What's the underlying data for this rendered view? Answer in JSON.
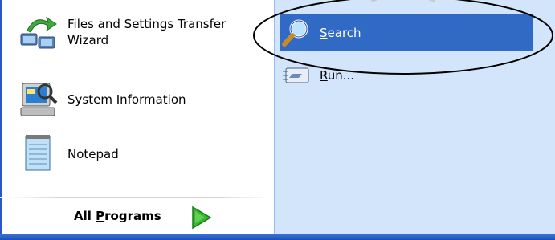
{
  "left_pane": {
    "items": [
      {
        "label_line1": "Files and Settings Transfer",
        "label_line2": "Wizard",
        "icon": "transfer-wizard-icon"
      },
      {
        "label": "System Information",
        "icon": "system-information-icon"
      },
      {
        "label": "Notepad",
        "icon": "notepad-icon"
      }
    ]
  },
  "all_programs": {
    "label_prefix": "All ",
    "label_accel": "P",
    "label_rest": "rograms",
    "icon": "green-arrow-icon"
  },
  "right_pane": {
    "items": [
      {
        "label_accel": "S",
        "label_rest": "earch",
        "icon": "search-icon",
        "state": "highlighted"
      },
      {
        "label_accel": "R",
        "label_rest": "un...",
        "icon": "run-icon"
      }
    ]
  },
  "colors": {
    "highlight": "#316ac5",
    "right_bg": "#d3e5fa",
    "accent_border": "#2a56c8"
  }
}
